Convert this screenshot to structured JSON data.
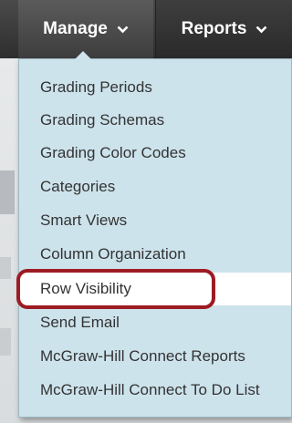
{
  "nav": {
    "tabs": [
      {
        "label": "Manage",
        "icon": "chevron-down-icon"
      },
      {
        "label": "Reports",
        "icon": "chevron-down-icon"
      }
    ]
  },
  "menu": {
    "items": [
      {
        "label": "Grading Periods"
      },
      {
        "label": "Grading Schemas"
      },
      {
        "label": "Grading Color Codes"
      },
      {
        "label": "Categories"
      },
      {
        "label": "Smart Views"
      },
      {
        "label": "Column Organization"
      },
      {
        "label": "Row Visibility"
      },
      {
        "label": "Send Email"
      },
      {
        "label": "McGraw-Hill Connect Reports"
      },
      {
        "label": "McGraw-Hill Connect To Do List"
      }
    ],
    "highlighted_index": 6
  },
  "colors": {
    "nav_bg": "#333333",
    "menu_bg": "#cde3ec",
    "callout": "#9e1b23"
  }
}
